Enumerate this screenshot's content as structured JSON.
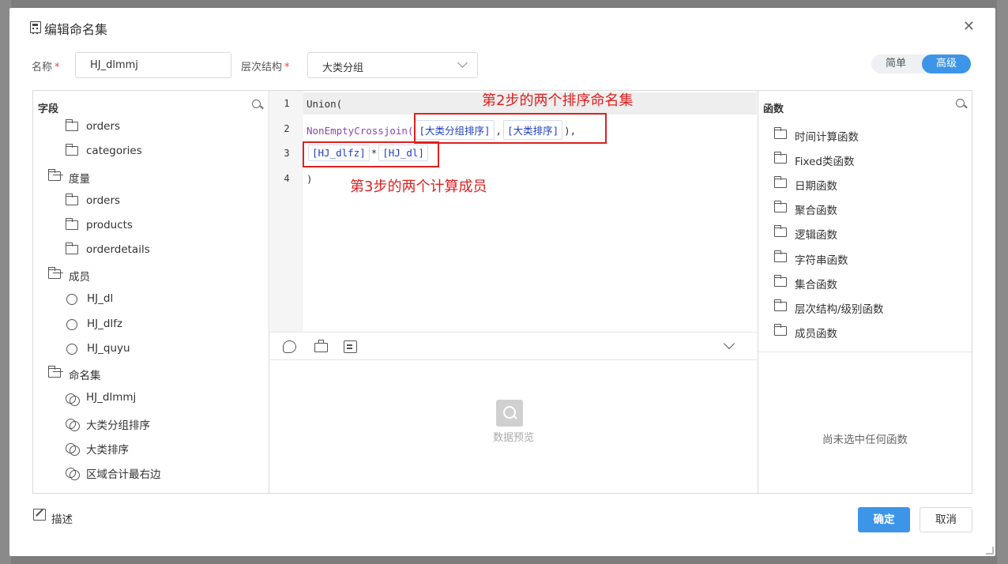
{
  "dialog": {
    "title": "编辑命名集",
    "close_glyph": "✕"
  },
  "form": {
    "name_label": "名称",
    "name_value": "HJ_dlmmj",
    "hierarchy_label": "层次结构",
    "hierarchy_value": "大类分组",
    "required_mark": "*"
  },
  "mode_toggle": {
    "simple": "简单",
    "advanced": "高级",
    "selected": "advanced"
  },
  "fields_panel": {
    "title": "字段",
    "tree": [
      {
        "label": "orders",
        "icon": "folder-icon"
      },
      {
        "label": "categories",
        "icon": "folder-icon"
      },
      {
        "label": "度量",
        "icon": "folder-open-icon"
      },
      {
        "label": "orders",
        "icon": "folder-icon"
      },
      {
        "label": "products",
        "icon": "folder-icon"
      },
      {
        "label": "orderdetails",
        "icon": "folder-icon"
      },
      {
        "label": "成员",
        "icon": "folder-open-icon"
      },
      {
        "label": "HJ_dl",
        "icon": "member-icon"
      },
      {
        "label": "HJ_dlfz",
        "icon": "member-icon"
      },
      {
        "label": "HJ_quyu",
        "icon": "member-icon"
      },
      {
        "label": "命名集",
        "icon": "folder-open-icon"
      },
      {
        "label": "HJ_dlmmj",
        "icon": "named-set-icon"
      },
      {
        "label": "大类分组排序",
        "icon": "named-set-icon"
      },
      {
        "label": "大类排序",
        "icon": "named-set-icon"
      },
      {
        "label": "区域合计最右边",
        "icon": "named-set-icon"
      }
    ]
  },
  "editor": {
    "line_numbers": [
      "1",
      "2",
      "3",
      "4"
    ],
    "line1": "Union(",
    "line2_fn": "NonEmptyCrossjoin(",
    "line2_tok1": "[大类分组排序]",
    "line2_sep": ",",
    "line2_tok2": "[大类排序]",
    "line2_end": "),",
    "line3_tok1": "[HJ_dlfz]",
    "line3_op": "*",
    "line3_tok2": "[HJ_dl]",
    "line4": ")"
  },
  "annotations": {
    "step2": "第2步的两个排序命名集",
    "step3": "第3步的两个计算成员",
    "color": "#e02020"
  },
  "preview": {
    "empty_text": "数据预览"
  },
  "functions_panel": {
    "title": "函数",
    "items": [
      "时间计算函数",
      "Fixed类函数",
      "日期函数",
      "聚合函数",
      "逻辑函数",
      "字符串函数",
      "集合函数",
      "层次结构/级别函数",
      "成员函数"
    ],
    "empty_text": "尚未选中任何函数"
  },
  "footer": {
    "describe": "描述",
    "ok": "确定",
    "cancel": "取消"
  },
  "colors": {
    "accent": "#3d95e8",
    "token_text": "#1f3fbf",
    "function_text": "#8e44ad"
  }
}
